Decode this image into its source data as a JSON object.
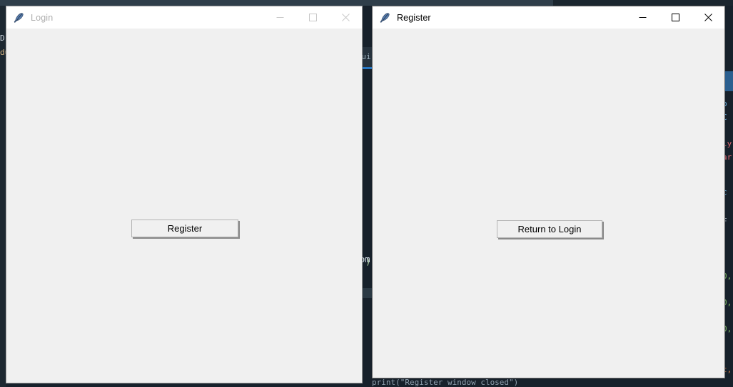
{
  "desktop": {
    "background_app": "code-editor",
    "background_color": "#17212b",
    "tabstrip_color": "#2f3e4a",
    "gap_tab_label": "ui",
    "gap_code_fragment": "\")",
    "gap_right_fragment": "om",
    "left_code_fragments": [
      "D",
      "du"
    ],
    "right_code_fragments": [
      "b",
      "C",
      "ly",
      "ar",
      "c",
      "F",
      "0,",
      "0,",
      "0,",
      "t,"
    ],
    "bottom_code_fragment": "print(\"Register window closed\")"
  },
  "windows": [
    {
      "id": "login",
      "title": "Login",
      "icon": "feather-icon",
      "active": false,
      "controls": {
        "minimize": "minimize-icon",
        "maximize": "maximize-icon",
        "close": "close-icon"
      },
      "button": {
        "label": "Register",
        "name": "register-button"
      }
    },
    {
      "id": "register",
      "title": "Register",
      "icon": "feather-icon",
      "active": true,
      "controls": {
        "minimize": "minimize-icon",
        "maximize": "maximize-icon",
        "close": "close-icon"
      },
      "button": {
        "label": "Return to Login",
        "name": "return-to-login-button"
      }
    }
  ],
  "colors": {
    "window_client": "#f0f0f0",
    "titlebar": "#ffffff",
    "title_active": "#000000",
    "title_inactive": "#aeaeae",
    "button_face": "#f0f0f0",
    "button_border": "#b4b4b4",
    "button_shadow": "#8a8a8a",
    "editor_bg": "#17212b",
    "accent_blue": "#2777c4"
  }
}
